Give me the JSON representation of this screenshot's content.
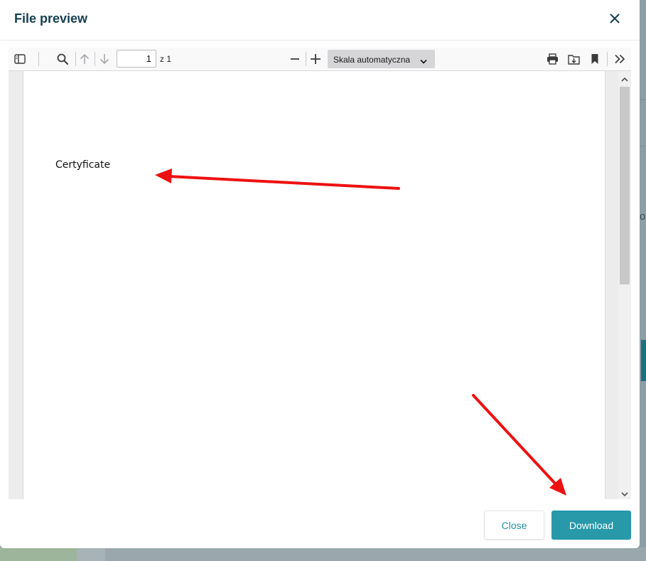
{
  "dialog": {
    "title": "File preview",
    "close_icon": "close-icon",
    "close_label": "Close",
    "download_label": "Download"
  },
  "viewer": {
    "toolbar": {
      "sidebar_toggle_icon": "sidebar-toggle-icon",
      "search_icon": "search-icon",
      "prev_page_icon": "arrow-up-icon",
      "next_page_icon": "arrow-down-icon",
      "page_number": "1",
      "page_of": "z 1",
      "zoom_out_icon": "minus-icon",
      "zoom_in_icon": "plus-icon",
      "zoom_label": "Skala automatyczna",
      "print_icon": "print-icon",
      "save_icon": "save-icon",
      "bookmark_icon": "bookmark-icon",
      "more_icon": "double-chevron-right-icon"
    },
    "document": {
      "text": "Certyficate"
    }
  },
  "background": {
    "partial_text": "o"
  },
  "colors": {
    "title": "#163e52",
    "accent": "#2799a9",
    "annotation": "#ee1111"
  }
}
